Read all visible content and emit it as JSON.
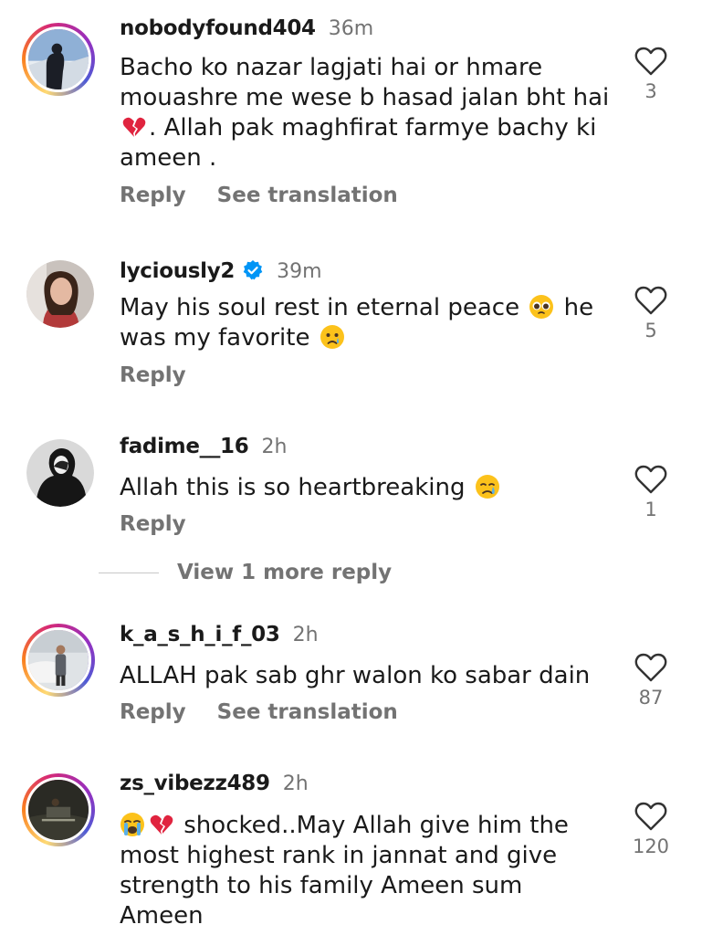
{
  "comments": [
    {
      "username": "nobodyfound404",
      "time": "36m",
      "text_parts": [
        "Bacho ko nazar lagjati hai or hmare mouashre me wese b hasad jalan bht hai ",
        ". Allah pak maghfirat farmye bachy ki ameen ."
      ],
      "emojis": [
        "broken-heart"
      ],
      "actions": [
        "Reply",
        "See translation"
      ],
      "likes": "3"
    },
    {
      "username": "lyciously2",
      "verified": true,
      "time": "39m",
      "text_parts": [
        "May his soul rest in eternal peace ",
        " he was my favorite "
      ],
      "emojis": [
        "pleading-face",
        "sad-face"
      ],
      "actions": [
        "Reply"
      ],
      "likes": "5"
    },
    {
      "username": "fadime__16",
      "time": "2h",
      "text_parts": [
        "Allah this is so heartbreaking "
      ],
      "emojis": [
        "crying-face"
      ],
      "actions": [
        "Reply"
      ],
      "likes": "1"
    },
    {
      "username": "k_a_s_h_i_f_03",
      "time": "2h",
      "text_parts": [
        "ALLAH pak sab ghr walon ko sabar dain"
      ],
      "emojis": [],
      "actions": [
        "Reply",
        "See translation"
      ],
      "likes": "87"
    },
    {
      "username": "zs_vibezz489",
      "time": "2h",
      "text_parts": [
        "",
        "",
        " shocked..May Allah give him the most highest rank in jannat and give strength to his family Ameen sum Ameen"
      ],
      "emojis": [
        "loudly-crying-face",
        "broken-heart"
      ],
      "actions": [],
      "likes": "120"
    }
  ],
  "view_more_replies": "View 1 more reply",
  "colors": {
    "secondary_text": "#737373",
    "verified_blue": "#0095f6",
    "story_ring": [
      "#feda75",
      "#fa7e1e",
      "#d62976",
      "#962fbf",
      "#4f5bd5"
    ]
  },
  "icons": {
    "like": "heart-outline-icon",
    "verified": "verified-badge-icon"
  }
}
